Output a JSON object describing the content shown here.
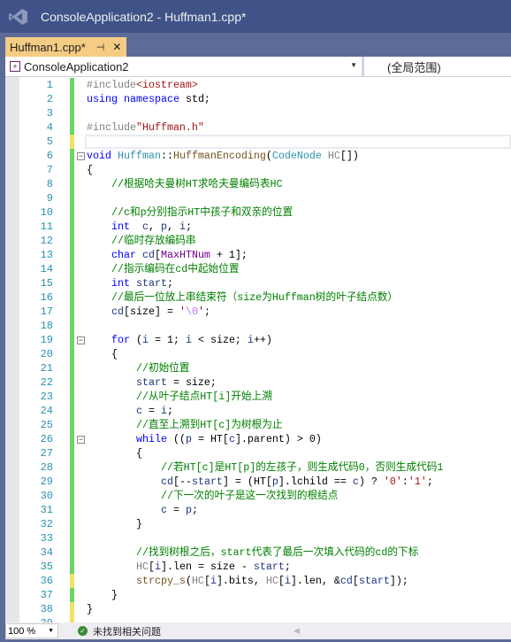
{
  "window": {
    "title": "ConsoleApplication2 - Huffman1.cpp*"
  },
  "tab": {
    "label": "Huffman1.cpp*",
    "pin_icon": "pin-icon",
    "close_icon": "close-icon"
  },
  "navbar": {
    "project": "ConsoleApplication2",
    "scope": "(全局范围)"
  },
  "status": {
    "zoom": "100 %",
    "issues": "未找到相关问题"
  },
  "colors": {
    "title_bar": "#3f5389",
    "tab_active": "#f5cc84",
    "change_saved": "#6cd468",
    "change_unsaved": "#f1e267",
    "line_number": "#2b91af"
  },
  "editor": {
    "current_line": 5,
    "fold_lines": [
      6,
      19,
      26
    ],
    "unsaved_lines": [
      5,
      36,
      38,
      39
    ],
    "lines": [
      [
        [
          "#include",
          "pr"
        ],
        [
          "<iostream>",
          "s"
        ]
      ],
      [
        [
          "using",
          "k"
        ],
        [
          " ",
          ""
        ],
        [
          "namespace",
          "k"
        ],
        [
          " std;",
          ""
        ]
      ],
      [],
      [
        [
          "#include",
          "pr"
        ],
        [
          "\"Huffman.h\"",
          "s"
        ]
      ],
      [],
      [
        [
          "void",
          "k"
        ],
        [
          " ",
          ""
        ],
        [
          "Huffman",
          "t"
        ],
        [
          "::",
          ""
        ],
        [
          "HuffmanEncoding",
          "f"
        ],
        [
          "(",
          ""
        ],
        [
          "CodeNode",
          "t"
        ],
        [
          " ",
          ""
        ],
        [
          "HC",
          "p"
        ],
        [
          "[])",
          ""
        ]
      ],
      [
        [
          "{",
          ""
        ]
      ],
      [
        [
          "    ",
          ""
        ],
        [
          "//根据哈夫曼树HT求哈夫曼编码表HC",
          "c"
        ]
      ],
      [],
      [
        [
          "    ",
          ""
        ],
        [
          "//c和p分别指示HT中孩子和双亲的位置",
          "c"
        ]
      ],
      [
        [
          "    ",
          ""
        ],
        [
          "int",
          "k"
        ],
        [
          "  ",
          ""
        ],
        [
          "c",
          "v"
        ],
        [
          ", ",
          ""
        ],
        [
          "p",
          "v"
        ],
        [
          ", ",
          ""
        ],
        [
          "i",
          "v"
        ],
        [
          ";",
          ""
        ]
      ],
      [
        [
          "    ",
          ""
        ],
        [
          "//临时存放编码串",
          "c"
        ]
      ],
      [
        [
          "    ",
          ""
        ],
        [
          "char",
          "k"
        ],
        [
          " ",
          ""
        ],
        [
          "cd",
          "v"
        ],
        [
          "[",
          ""
        ],
        [
          "MaxHTNum",
          "m"
        ],
        [
          " + 1];",
          ""
        ]
      ],
      [
        [
          "    ",
          ""
        ],
        [
          "//指示编码在cd中起始位置",
          "c"
        ]
      ],
      [
        [
          "    ",
          ""
        ],
        [
          "int",
          "k"
        ],
        [
          " ",
          ""
        ],
        [
          "start",
          "v"
        ],
        [
          ";",
          ""
        ]
      ],
      [
        [
          "    ",
          ""
        ],
        [
          "//最后一位放上串结束符（size为Huffman树的叶子结点数）",
          "c"
        ]
      ],
      [
        [
          "    ",
          ""
        ],
        [
          "cd",
          "v"
        ],
        [
          "[size] = ",
          ""
        ],
        [
          "'",
          "s"
        ],
        [
          "\\0",
          "esc"
        ],
        [
          "'",
          "s"
        ],
        [
          ";",
          ""
        ]
      ],
      [],
      [
        [
          "    ",
          ""
        ],
        [
          "for",
          "k"
        ],
        [
          " (",
          ""
        ],
        [
          "i",
          "v"
        ],
        [
          " = 1; ",
          ""
        ],
        [
          "i",
          "v"
        ],
        [
          " < size; ",
          ""
        ],
        [
          "i",
          "v"
        ],
        [
          "++)",
          ""
        ]
      ],
      [
        [
          "    {",
          ""
        ]
      ],
      [
        [
          "        ",
          ""
        ],
        [
          "//初始位置",
          "c"
        ]
      ],
      [
        [
          "        ",
          ""
        ],
        [
          "start",
          "v"
        ],
        [
          " = size;",
          ""
        ]
      ],
      [
        [
          "        ",
          ""
        ],
        [
          "//从叶子结点HT[i]开始上溯",
          "c"
        ]
      ],
      [
        [
          "        ",
          ""
        ],
        [
          "c",
          "v"
        ],
        [
          " = ",
          ""
        ],
        [
          "i",
          "v"
        ],
        [
          ";",
          ""
        ]
      ],
      [
        [
          "        ",
          ""
        ],
        [
          "//直至上溯到HT[c]为树根为止",
          "c"
        ]
      ],
      [
        [
          "        ",
          ""
        ],
        [
          "while",
          "k"
        ],
        [
          " ((",
          ""
        ],
        [
          "p",
          "v"
        ],
        [
          " = HT[",
          ""
        ],
        [
          "c",
          "v"
        ],
        [
          "].parent) > 0)",
          ""
        ]
      ],
      [
        [
          "        {",
          ""
        ]
      ],
      [
        [
          "            ",
          ""
        ],
        [
          "//若HT[c]是HT[p]的左孩子，则生成代码0，否则生成代码1",
          "c"
        ]
      ],
      [
        [
          "            ",
          ""
        ],
        [
          "cd",
          "v"
        ],
        [
          "[--",
          ""
        ],
        [
          "start",
          "v"
        ],
        [
          "] = (HT[",
          ""
        ],
        [
          "p",
          "v"
        ],
        [
          "].lchild == ",
          ""
        ],
        [
          "c",
          "v"
        ],
        [
          ") ? ",
          ""
        ],
        [
          "'0'",
          "s"
        ],
        [
          ":",
          ""
        ],
        [
          "'1'",
          "s"
        ],
        [
          ";",
          ""
        ]
      ],
      [
        [
          "            ",
          ""
        ],
        [
          "//下一次的叶子是这一次找到的根结点",
          "c"
        ]
      ],
      [
        [
          "            ",
          ""
        ],
        [
          "c",
          "v"
        ],
        [
          " = ",
          ""
        ],
        [
          "p",
          "v"
        ],
        [
          ";",
          ""
        ]
      ],
      [
        [
          "        }",
          ""
        ]
      ],
      [],
      [
        [
          "        ",
          ""
        ],
        [
          "//找到树根之后，start代表了最后一次填入代码的cd的下标",
          "c"
        ]
      ],
      [
        [
          "        ",
          ""
        ],
        [
          "HC",
          "p"
        ],
        [
          "[",
          ""
        ],
        [
          "i",
          "v"
        ],
        [
          "].len = size - ",
          ""
        ],
        [
          "start",
          "v"
        ],
        [
          ";",
          ""
        ]
      ],
      [
        [
          "        ",
          ""
        ],
        [
          "strcpy_s",
          "f"
        ],
        [
          "(",
          ""
        ],
        [
          "HC",
          "p"
        ],
        [
          "[",
          ""
        ],
        [
          "i",
          "v"
        ],
        [
          "].bits, ",
          ""
        ],
        [
          "HC",
          "p"
        ],
        [
          "[",
          ""
        ],
        [
          "i",
          "v"
        ],
        [
          "].len, &",
          ""
        ],
        [
          "cd",
          "v"
        ],
        [
          "[",
          ""
        ],
        [
          "start",
          "v"
        ],
        [
          "]);",
          ""
        ]
      ],
      [
        [
          "    }",
          ""
        ]
      ],
      [
        [
          "}",
          ""
        ]
      ],
      []
    ]
  }
}
